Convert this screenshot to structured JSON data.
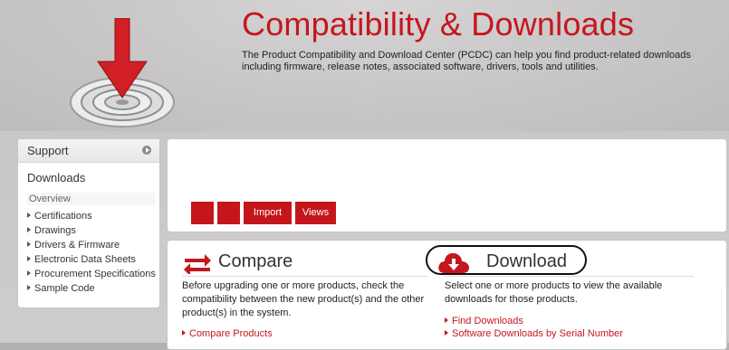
{
  "header": {
    "title": "Compatibility & Downloads",
    "intro": "The Product Compatibility and Download Center (PCDC) can help you find product-related downloads including firmware, release notes, associated software, drivers, tools and utilities."
  },
  "sidebar": {
    "support_label": "Support",
    "downloads_label": "Downloads",
    "overview_label": "Overview",
    "items": [
      {
        "label": "Certifications"
      },
      {
        "label": "Drawings"
      },
      {
        "label": "Drivers & Firmware"
      },
      {
        "label": "Electronic Data Sheets"
      },
      {
        "label": "Procurement Specifications"
      },
      {
        "label": "Sample Code"
      }
    ]
  },
  "tabs": [
    {
      "label": ""
    },
    {
      "label": ""
    },
    {
      "label": "Import"
    },
    {
      "label": "Views"
    }
  ],
  "compare": {
    "title": "Compare",
    "description": "Before upgrading one or more products, check the compatibility between the new product(s) and the other product(s) in the system.",
    "links": [
      {
        "label": "Compare Products"
      }
    ]
  },
  "download": {
    "title": "Download",
    "description": "Select one or more products to view the available downloads for those products.",
    "links": [
      {
        "label": "Find Downloads"
      },
      {
        "label": "Software Downloads by Serial Number"
      }
    ]
  },
  "icons": {
    "brand_red": "#c5161d",
    "target": "target-download-icon",
    "compare": "compare-arrows-icon",
    "download": "cloud-download-icon"
  }
}
